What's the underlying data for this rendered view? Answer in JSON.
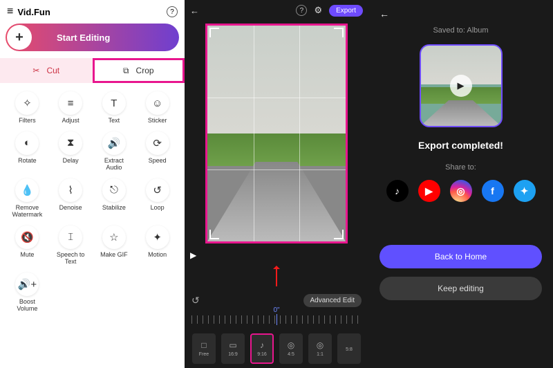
{
  "left": {
    "app_title": "Vid.Fun",
    "start_label": "Start Editing",
    "cut_label": "Cut",
    "crop_label": "Crop",
    "tools": [
      {
        "icon": "✧",
        "label": "Filters"
      },
      {
        "icon": "≡",
        "label": "Adjust"
      },
      {
        "icon": "T",
        "label": "Text"
      },
      {
        "icon": "☺",
        "label": "Sticker"
      },
      {
        "icon": "◐",
        "label": "Rotate"
      },
      {
        "icon": "⧗",
        "label": "Delay"
      },
      {
        "icon": "🔊",
        "label": "Extract\nAudio"
      },
      {
        "icon": "⟳",
        "label": "Speed"
      },
      {
        "icon": "💧",
        "label": "Remove\nWatermark"
      },
      {
        "icon": "⌇",
        "label": "Denoise"
      },
      {
        "icon": "⎋",
        "label": "Stabilize"
      },
      {
        "icon": "↺",
        "label": "Loop"
      },
      {
        "icon": "🔇",
        "label": "Mute"
      },
      {
        "icon": "𝙸",
        "label": "Speech to\nText"
      },
      {
        "icon": "☆",
        "label": "Make GIF"
      },
      {
        "icon": "✦",
        "label": "Motion"
      },
      {
        "icon": "🔊+",
        "label": "Boost\nVolume"
      }
    ]
  },
  "mid": {
    "export_label": "Export",
    "advanced_label": "Advanced Edit",
    "time_marker": "0\"",
    "ratios": [
      {
        "icon": "□",
        "label": "Free"
      },
      {
        "icon": "▭",
        "label": "16:9"
      },
      {
        "icon": "♪",
        "label": "9:16",
        "selected": true
      },
      {
        "icon": "◎",
        "label": "4:5"
      },
      {
        "icon": "◎",
        "label": "1:1"
      },
      {
        "icon": "",
        "label": "5:8"
      }
    ]
  },
  "right": {
    "saved_to": "Saved to: Album",
    "completed": "Export completed!",
    "share_to": "Share to:",
    "socials": [
      {
        "name": "tiktok",
        "glyph": "♪"
      },
      {
        "name": "youtube",
        "glyph": "▶"
      },
      {
        "name": "instagram",
        "glyph": "◎"
      },
      {
        "name": "facebook",
        "glyph": "f"
      },
      {
        "name": "twitter",
        "glyph": "✦"
      }
    ],
    "back_home": "Back to Home",
    "keep_edit": "Keep editing"
  }
}
